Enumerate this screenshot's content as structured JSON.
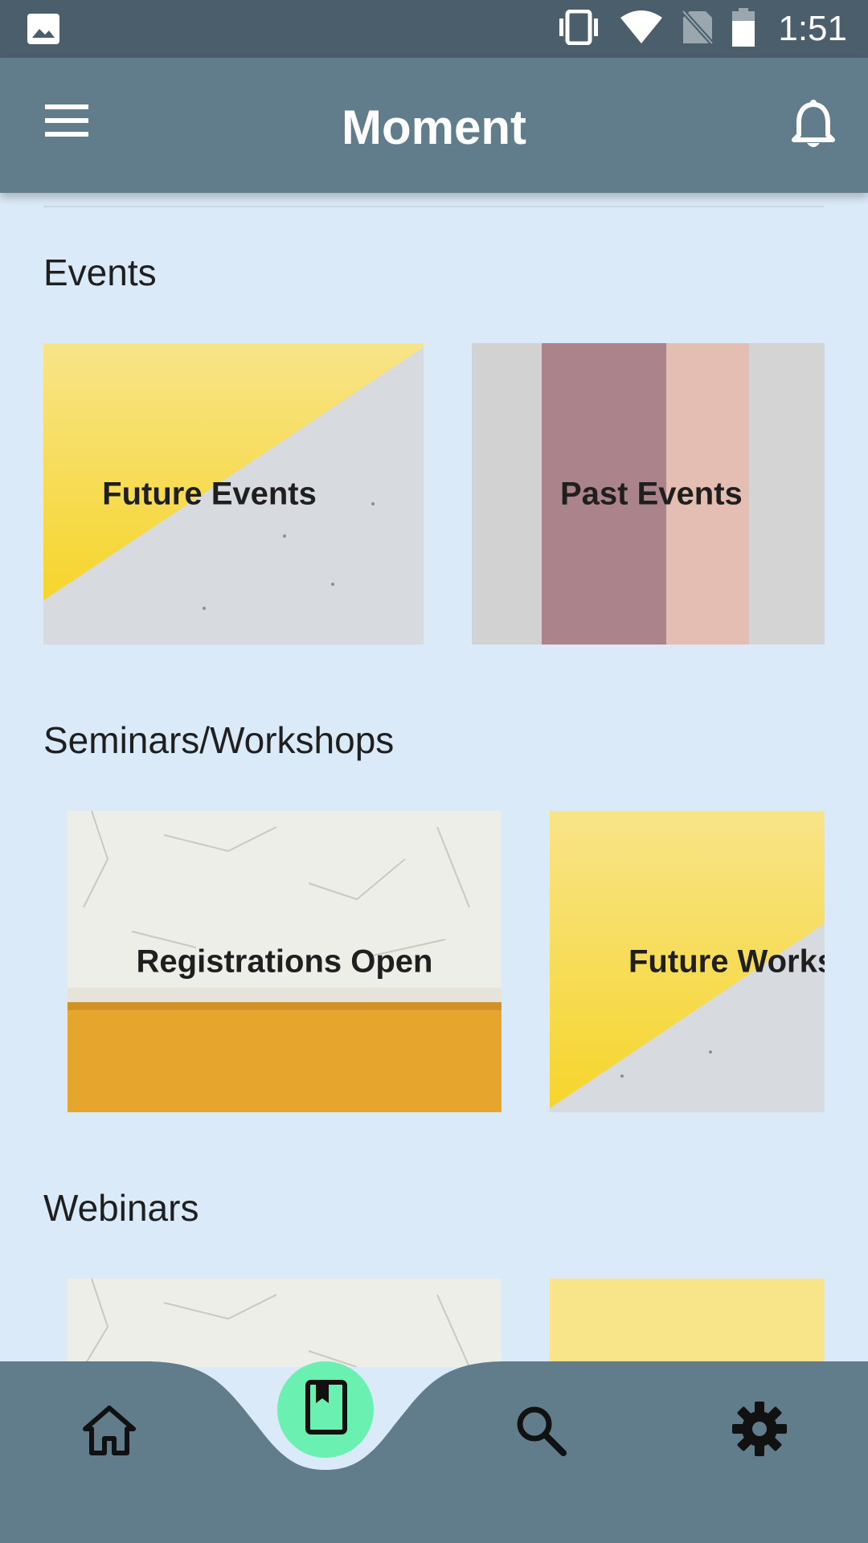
{
  "status_bar": {
    "time": "1:51",
    "icons": [
      "image-icon",
      "vibrate-icon",
      "wifi-icon",
      "no-sim-icon",
      "battery-icon"
    ]
  },
  "app_bar": {
    "title": "Moment",
    "left_icon": "menu-icon",
    "right_icon": "bell-icon"
  },
  "sections": [
    {
      "title": "Events",
      "cards": [
        {
          "label": "Future Events",
          "image": "yellow-diagonal"
        },
        {
          "label": "Past Events",
          "image": "vertical-stripes"
        }
      ]
    },
    {
      "title": "Seminars/Workshops",
      "cards": [
        {
          "label": "Registrations Open",
          "image": "white-wall-orange"
        },
        {
          "label": "Future Works",
          "image": "yellow-diagonal"
        }
      ]
    },
    {
      "title": "Webinars",
      "cards": [
        {
          "label": "",
          "image": "white-wall-orange"
        },
        {
          "label": "",
          "image": "yellow-diagonal"
        }
      ]
    }
  ],
  "bottom_nav": {
    "items": [
      "home-icon",
      "book-icon",
      "search-icon",
      "settings-icon"
    ],
    "active": "book-icon"
  },
  "colors": {
    "status_bar": "#4a5f6b",
    "app_bar": "#617d8b",
    "background": "#daeaf8",
    "fab": "#6af0b0",
    "yellow": "#f7dd3a",
    "concrete": "#d5dadf"
  }
}
